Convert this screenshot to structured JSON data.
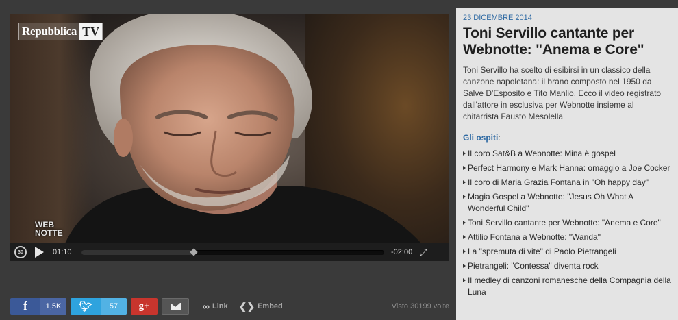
{
  "player": {
    "logo_word": "Repubblica",
    "logo_tv": "TV",
    "watermark_line1": "WEB",
    "watermark_line2": "NOTTE",
    "replay_icon_label": "30",
    "current_time": "01:10",
    "remaining_time": "-02:00",
    "progress": 0.37
  },
  "share": {
    "facebook_count": "1,5K",
    "twitter_count": "57",
    "link_label": "Link",
    "embed_label": "Embed",
    "views": "Visto 30199 volte"
  },
  "icons": [
    "replay-icon",
    "play-icon",
    "fullscreen-icon",
    "facebook-icon",
    "twitter-icon",
    "google-plus-icon",
    "mail-icon",
    "link-icon",
    "embed-icon"
  ],
  "article": {
    "date": "23 DICEMBRE 2014",
    "title": "Toni Servillo cantante per Webnotte: \"Anema e Core\"",
    "description": "Toni Servillo ha scelto di esibirsi in un classico della canzone napoletana: il brano composto nel 1950 da Salve D'Esposito e Tito Manlio. Ecco il video registrato dall'attore in esclusiva per Webnotte insieme al chitarrista Fausto Mesolella",
    "guests_heading": "Gli ospiti",
    "guests_colon": ":",
    "guests": [
      "Il coro Sat&B a Webnotte: Mina è gospel",
      "Perfect Harmony e Mark Hanna: omaggio a Joe Cocker",
      "Il coro di Maria Grazia Fontana in \"Oh happy day\"",
      "Magia Gospel a Webnotte: \"Jesus Oh What A Wonderful Child\"",
      "Toni Servillo cantante per Webnotte: \"Anema e Core\"",
      "Attilio Fontana a Webnotte: \"Wanda\"",
      "La \"spremuta di vite\" di Paolo Pietrangeli",
      "Pietrangeli: \"Contessa\" diventa rock",
      "Il medley di canzoni romanesche della Compagnia della Luna"
    ]
  }
}
